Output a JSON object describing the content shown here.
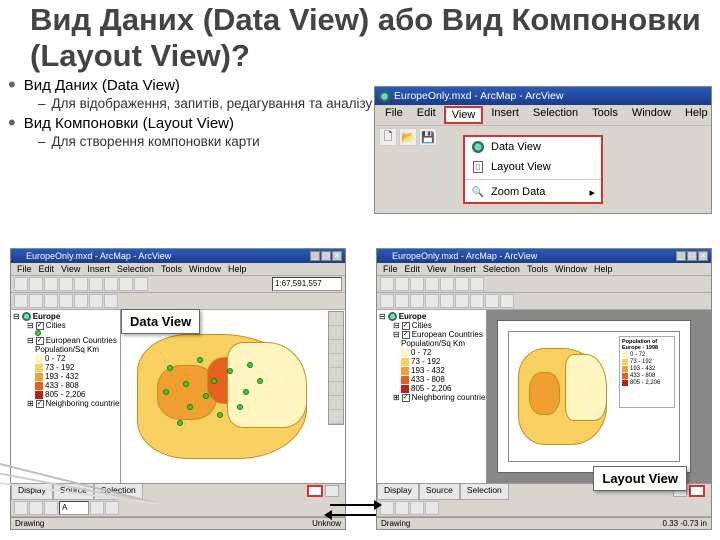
{
  "title": "Вид Даних (Data View) або Вид Компоновки (Layout View)?",
  "bullets": {
    "b1": "Вид Даних (Data View)",
    "b1sub": "Для відображення, запитів, редагування та аналізу",
    "b2": "Вид Компоновки (Layout View)",
    "b2sub": "Для створення компоновки карти"
  },
  "dropdown": {
    "window_title": "EuropeOnly.mxd - ArcMap - ArcView",
    "menus": [
      "File",
      "Edit",
      "View",
      "Insert",
      "Selection",
      "Tools",
      "Window",
      "Help"
    ],
    "view_menu": {
      "data_view": "Data View",
      "layout_view": "Layout View",
      "zoom_data": "Zoom Data"
    }
  },
  "left_shot": {
    "window_title": "EuropeOnly.mxd - ArcMap - ArcView",
    "menus": [
      "File",
      "Edit",
      "View",
      "Insert",
      "Selection",
      "Tools",
      "Window",
      "Help"
    ],
    "scale": "1:67,591,557",
    "toc": {
      "root": "Europe",
      "layer1": "Cities",
      "layer2": "European Countries",
      "field": "Population/Sq Km",
      "classes": [
        {
          "label": "0 - 72",
          "color": "#fff5c0"
        },
        {
          "label": "73 - 192",
          "color": "#f8d060"
        },
        {
          "label": "193 - 432",
          "color": "#f0a030"
        },
        {
          "label": "433 - 808",
          "color": "#e86020"
        },
        {
          "label": "805 - 2,206",
          "color": "#c02010"
        }
      ],
      "layer3": "Neighboring countries"
    },
    "tabs": [
      "Display",
      "Source",
      "Selection"
    ],
    "status_left": "Drawing",
    "status_right": "Unknow"
  },
  "right_shot": {
    "window_title": "EuropeOnly.mxd - ArcMap - ArcView",
    "menus": [
      "File",
      "Edit",
      "View",
      "Insert",
      "Selection",
      "Tools",
      "Window",
      "Help"
    ],
    "toc": {
      "root": "Europe",
      "layer1": "Cities",
      "layer2": "European Countries",
      "field": "Population/Sq Km",
      "classes": [
        {
          "label": "0 - 72",
          "color": "#fff5c0"
        },
        {
          "label": "73 - 192",
          "color": "#f8d060"
        },
        {
          "label": "193 - 432",
          "color": "#f0a030"
        },
        {
          "label": "433 - 808",
          "color": "#e86020"
        },
        {
          "label": "805 - 2,206",
          "color": "#c02010"
        }
      ],
      "layer3": "Neighboring countries"
    },
    "legend_title": "Population of Europe - 1998",
    "tabs": [
      "Display",
      "Source",
      "Selection"
    ],
    "status_left": "Drawing",
    "status_right": "0.33 -0.73 in"
  },
  "callouts": {
    "data_view": "Data View",
    "layout_view": "Layout View"
  }
}
